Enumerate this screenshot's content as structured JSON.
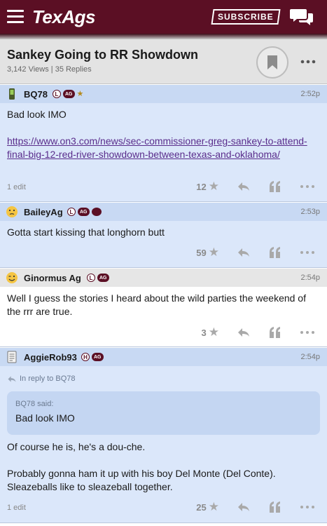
{
  "header": {
    "brand": "TexAgs",
    "subscribe_label": "SUBSCRIBE"
  },
  "thread": {
    "title": "Sankey Going to RR Showdown",
    "meta": "3,142 Views | 35 Replies"
  },
  "posts": [
    {
      "username": "BQ78",
      "time": "2:52p",
      "body_line1": "Bad look IMO",
      "link": "https://www.on3.com/news/sec-commissioner-greg-sankey-to-attend-final-big-12-red-river-showdown-between-texas-and-oklahoma/",
      "edited": "1 edit",
      "likes": "12"
    },
    {
      "username": "BaileyAg",
      "time": "2:53p",
      "body": "Gotta start kissing that longhorn butt",
      "likes": "59"
    },
    {
      "username": "Ginormus Ag",
      "time": "2:54p",
      "body": "Well I guess the stories I heard about the wild parties the weekend of the rrr are true.",
      "likes": "3"
    },
    {
      "username": "AggieRob93",
      "time": "2:54p",
      "in_reply": "In reply to BQ78",
      "quote_author": "BQ78 said:",
      "quote_text": "Bad look IMO",
      "body_p1": "Of course he is, he's a dou-che.",
      "body_p2": "Probably gonna ham it up with his boy Del Monte (Del Conte). Sleazeballs like to sleazeball together.",
      "edited": "1 edit",
      "likes": "25"
    }
  ],
  "badges": {
    "L": "L",
    "H": "H",
    "AG": "AG"
  },
  "colors": {
    "maroon": "#5b0f24",
    "post_blue": "#dbe7fa",
    "post_head_blue": "#c8d9f3",
    "link_purple": "#5a2d8c"
  }
}
